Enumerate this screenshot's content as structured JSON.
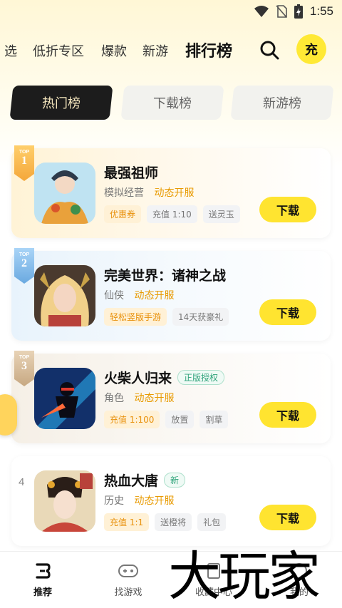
{
  "status": {
    "time": "1:55"
  },
  "nav": {
    "tabs": [
      "选",
      "低折专区",
      "爆款",
      "新游",
      "排行榜"
    ],
    "active_tab": "排行榜",
    "charge_label": "充"
  },
  "ranking_tabs": [
    {
      "label": "热门榜",
      "active": true
    },
    {
      "label": "下载榜",
      "active": false
    },
    {
      "label": "新游榜",
      "active": false
    }
  ],
  "rank_badge_text": "TOP",
  "games": [
    {
      "rank": "1",
      "title": "最强祖师",
      "title_tag": "",
      "category": "模拟经营",
      "hot": "动态开服",
      "tags": [
        "优惠券",
        "充值 1:10",
        "送灵玉"
      ],
      "highlight_tag": 0,
      "download": "下载"
    },
    {
      "rank": "2",
      "title": "完美世界：诸神之战",
      "title_tag": "",
      "category": "仙侠",
      "hot": "动态开服",
      "tags": [
        "轻松竖版手游",
        "14天获豪礼"
      ],
      "highlight_tag": 0,
      "download": "下载"
    },
    {
      "rank": "3",
      "title": "火柴人归来",
      "title_tag": "正版授权",
      "category": "角色",
      "hot": "动态开服",
      "tags": [
        "充值 1:100",
        "放置",
        "割草"
      ],
      "highlight_tag": 0,
      "download": "下载"
    },
    {
      "rank": "4",
      "title": "热血大唐",
      "title_tag": "新",
      "category": "历史",
      "hot": "动态开服",
      "tags": [
        "充值 1:1",
        "送橙将",
        "礼包"
      ],
      "highlight_tag": 0,
      "download": "下载"
    }
  ],
  "bottom_nav": [
    {
      "label": "推荐",
      "icon": "recommend-icon",
      "active": true
    },
    {
      "label": "找游戏",
      "icon": "gamepad-icon",
      "active": false
    },
    {
      "label": "收藏中心",
      "icon": "collection-icon",
      "active": false
    },
    {
      "label": "我的",
      "icon": "profile-icon",
      "active": false
    }
  ],
  "watermark": "大玩家",
  "colors": {
    "accent_yellow": "#ffe430",
    "hot_orange": "#e89a00",
    "dark_tab": "#1c1c1c"
  }
}
